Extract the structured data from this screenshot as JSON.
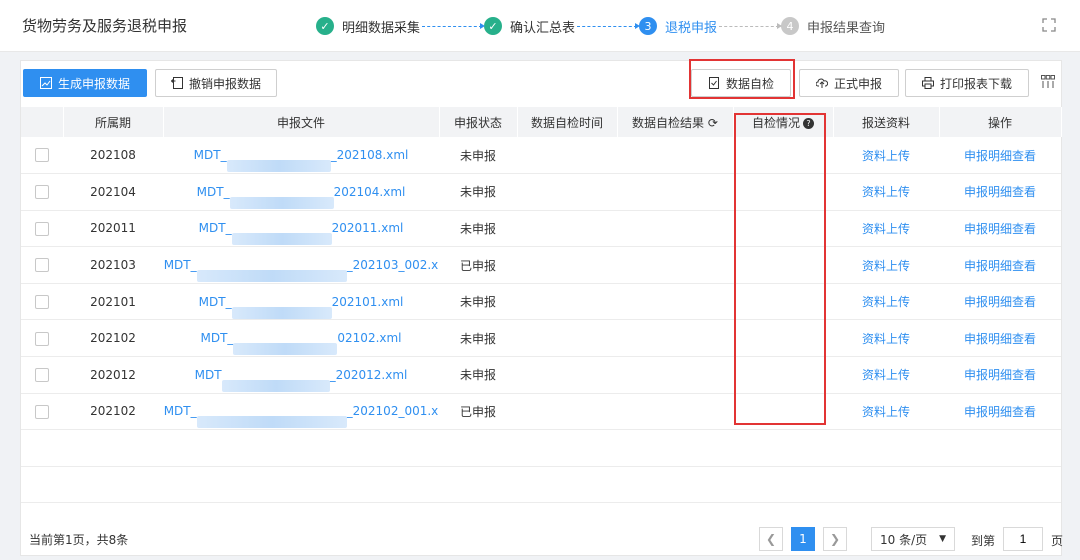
{
  "header": {
    "title": "货物劳务及服务退税申报",
    "steps": [
      {
        "label": "明细数据采集",
        "state": "done",
        "marker": "✓"
      },
      {
        "label": "确认汇总表",
        "state": "done",
        "marker": "✓"
      },
      {
        "label": "退税申报",
        "state": "active",
        "marker": "3"
      },
      {
        "label": "申报结果查询",
        "state": "todo",
        "marker": "4"
      }
    ]
  },
  "toolbar": {
    "generate_label": "生成申报数据",
    "revoke_label": "撤销申报数据",
    "selfcheck_label": "数据自检",
    "formal_label": "正式申报",
    "print_label": "打印报表下载"
  },
  "table": {
    "columns": [
      "所属期",
      "申报文件",
      "申报状态",
      "数据自检时间",
      "数据自检结果",
      "自检情况",
      "报送资料",
      "操作"
    ],
    "rows": [
      {
        "period": "202108",
        "file_prefix": "MDT_",
        "file_suffix": "_202108.xml",
        "status": "未申报",
        "upload": "资料上传",
        "action": "申报明细查看"
      },
      {
        "period": "202104",
        "file_prefix": "MDT_",
        "file_suffix": "202104.xml",
        "status": "未申报",
        "upload": "资料上传",
        "action": "申报明细查看"
      },
      {
        "period": "202011",
        "file_prefix": "MDT_",
        "file_suffix": "202011.xml",
        "status": "未申报",
        "upload": "资料上传",
        "action": "申报明细查看"
      },
      {
        "period": "202103",
        "file_prefix": "MDT_",
        "file_suffix": "_202103_002.x",
        "status": "已申报",
        "upload": "资料上传",
        "action": "申报明细查看"
      },
      {
        "period": "202101",
        "file_prefix": "MDT_",
        "file_suffix": "202101.xml",
        "status": "未申报",
        "upload": "资料上传",
        "action": "申报明细查看"
      },
      {
        "period": "202102",
        "file_prefix": "MDT_",
        "file_suffix": "02102.xml",
        "status": "未申报",
        "upload": "资料上传",
        "action": "申报明细查看"
      },
      {
        "period": "202012",
        "file_prefix": "MDT",
        "file_suffix": "_202012.xml",
        "status": "未申报",
        "upload": "资料上传",
        "action": "申报明细查看"
      },
      {
        "period": "202102",
        "file_prefix": "MDT_",
        "file_suffix": "_202102_001.x",
        "status": "已申报",
        "upload": "资料上传",
        "action": "申报明细查看"
      }
    ]
  },
  "pagination": {
    "info": "当前第1页，共8条",
    "current_page": "1",
    "page_size": "10 条/页",
    "goto_label": "到第",
    "goto_value": "1",
    "page_suffix": "页"
  },
  "colors": {
    "primary": "#2f8ff0",
    "done": "#27b08b",
    "highlight": "#e23434"
  }
}
